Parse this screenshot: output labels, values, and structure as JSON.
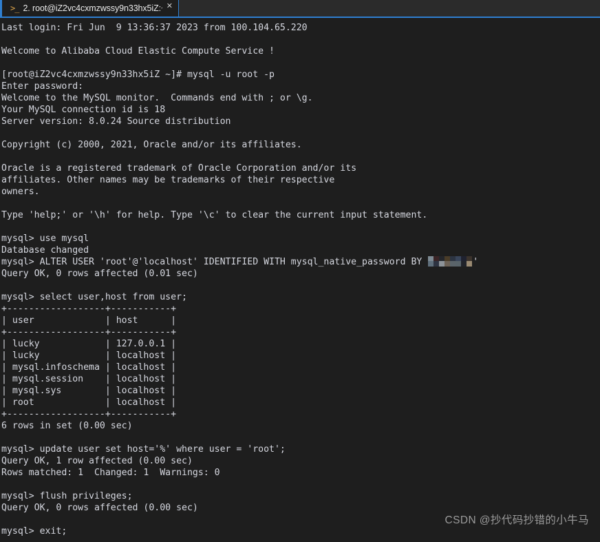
{
  "window": {
    "accent_color": "#2f7fd1",
    "background_color": "#1e1e1e",
    "tabbar_color": "#2b2b2b",
    "text_color": "#d6d8e0"
  },
  "tabbar": {
    "prompt_icon": ">_",
    "icon_name": "terminal-prompt-icon",
    "tab_title": "2. root@iZ2vc4cxmzwssy9n33hx5iZ:~",
    "close_label": "✕"
  },
  "terminal": {
    "lines": [
      "Last login: Fri Jun  9 13:36:37 2023 from 100.104.65.220",
      "",
      "Welcome to Alibaba Cloud Elastic Compute Service !",
      "",
      "[root@iZ2vc4cxmzwssy9n33hx5iZ ~]# mysql -u root -p",
      "Enter password:",
      "Welcome to the MySQL monitor.  Commands end with ; or \\g.",
      "Your MySQL connection id is 18",
      "Server version: 8.0.24 Source distribution",
      "",
      "Copyright (c) 2000, 2021, Oracle and/or its affiliates.",
      "",
      "Oracle is a registered trademark of Oracle Corporation and/or its",
      "affiliates. Other names may be trademarks of their respective",
      "owners.",
      "",
      "Type 'help;' or '\\h' for help. Type '\\c' to clear the current input statement.",
      "",
      "mysql> use mysql",
      "Database changed"
    ],
    "alter_user": {
      "prefix": "mysql> ALTER USER 'root'@'localhost' IDENTIFIED WITH mysql_native_password BY ",
      "redacted_label": "redacted-password",
      "suffix": "'"
    },
    "lines_after": [
      "Query OK, 0 rows affected (0.01 sec)",
      "",
      "mysql> select user,host from user;",
      "+------------------+-----------+",
      "| user             | host      |",
      "+------------------+-----------+",
      "| lucky            | 127.0.0.1 |",
      "| lucky            | localhost |",
      "| mysql.infoschema | localhost |",
      "| mysql.session    | localhost |",
      "| mysql.sys        | localhost |",
      "| root             | localhost |",
      "+------------------+-----------+",
      "6 rows in set (0.00 sec)",
      "",
      "mysql> update user set host='%' where user = 'root';",
      "Query OK, 1 row affected (0.00 sec)",
      "Rows matched: 1  Changed: 1  Warnings: 0",
      "",
      "mysql> flush privileges;",
      "Query OK, 0 rows affected (0.00 sec)",
      "",
      "mysql> exit;"
    ]
  },
  "watermark": {
    "text": "CSDN @抄代码抄错的小牛马"
  }
}
